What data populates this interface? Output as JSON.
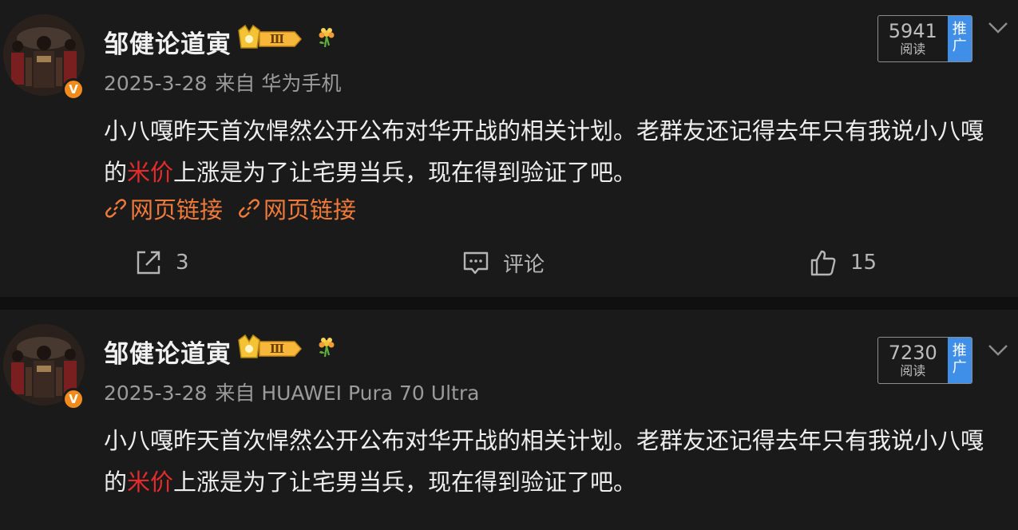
{
  "posts": [
    {
      "username": "邹健论道寅",
      "level_badge": "Ⅲ",
      "verified_badge": "V",
      "date": "2025-3-28",
      "source": "来自 华为手机",
      "read_count": "5941",
      "read_label": "阅读",
      "promo_label_1": "推",
      "promo_label_2": "广",
      "text_1": "小八嘎昨天首次悍然公开公布对华开战的相关计划。老群友还记得去年只有我说小八嘎的",
      "text_highlight": "米价",
      "text_2": "上涨是为了让宅男当兵，现在得到验证了吧。",
      "links": [
        "网页链接",
        "网页链接"
      ],
      "repost_count": "3",
      "comment_label": "评论",
      "like_count": "15"
    },
    {
      "username": "邹健论道寅",
      "level_badge": "Ⅲ",
      "verified_badge": "V",
      "date": "2025-3-28",
      "source": "来自 HUAWEI Pura 70 Ultra",
      "read_count": "7230",
      "read_label": "阅读",
      "promo_label_1": "推",
      "promo_label_2": "广",
      "text_1": "小八嘎昨天首次悍然公开公布对华开战的相关计划。老群友还记得去年只有我说小八嘎的",
      "text_highlight": "米价",
      "text_2": "上涨是为了让宅男当兵，现在得到验证了吧。"
    }
  ],
  "colors": {
    "background": "#1a1a1a",
    "link": "#f07a3a",
    "highlight": "#e52b2b",
    "promo": "#3f8fe8",
    "verified": "#f28b1b"
  }
}
